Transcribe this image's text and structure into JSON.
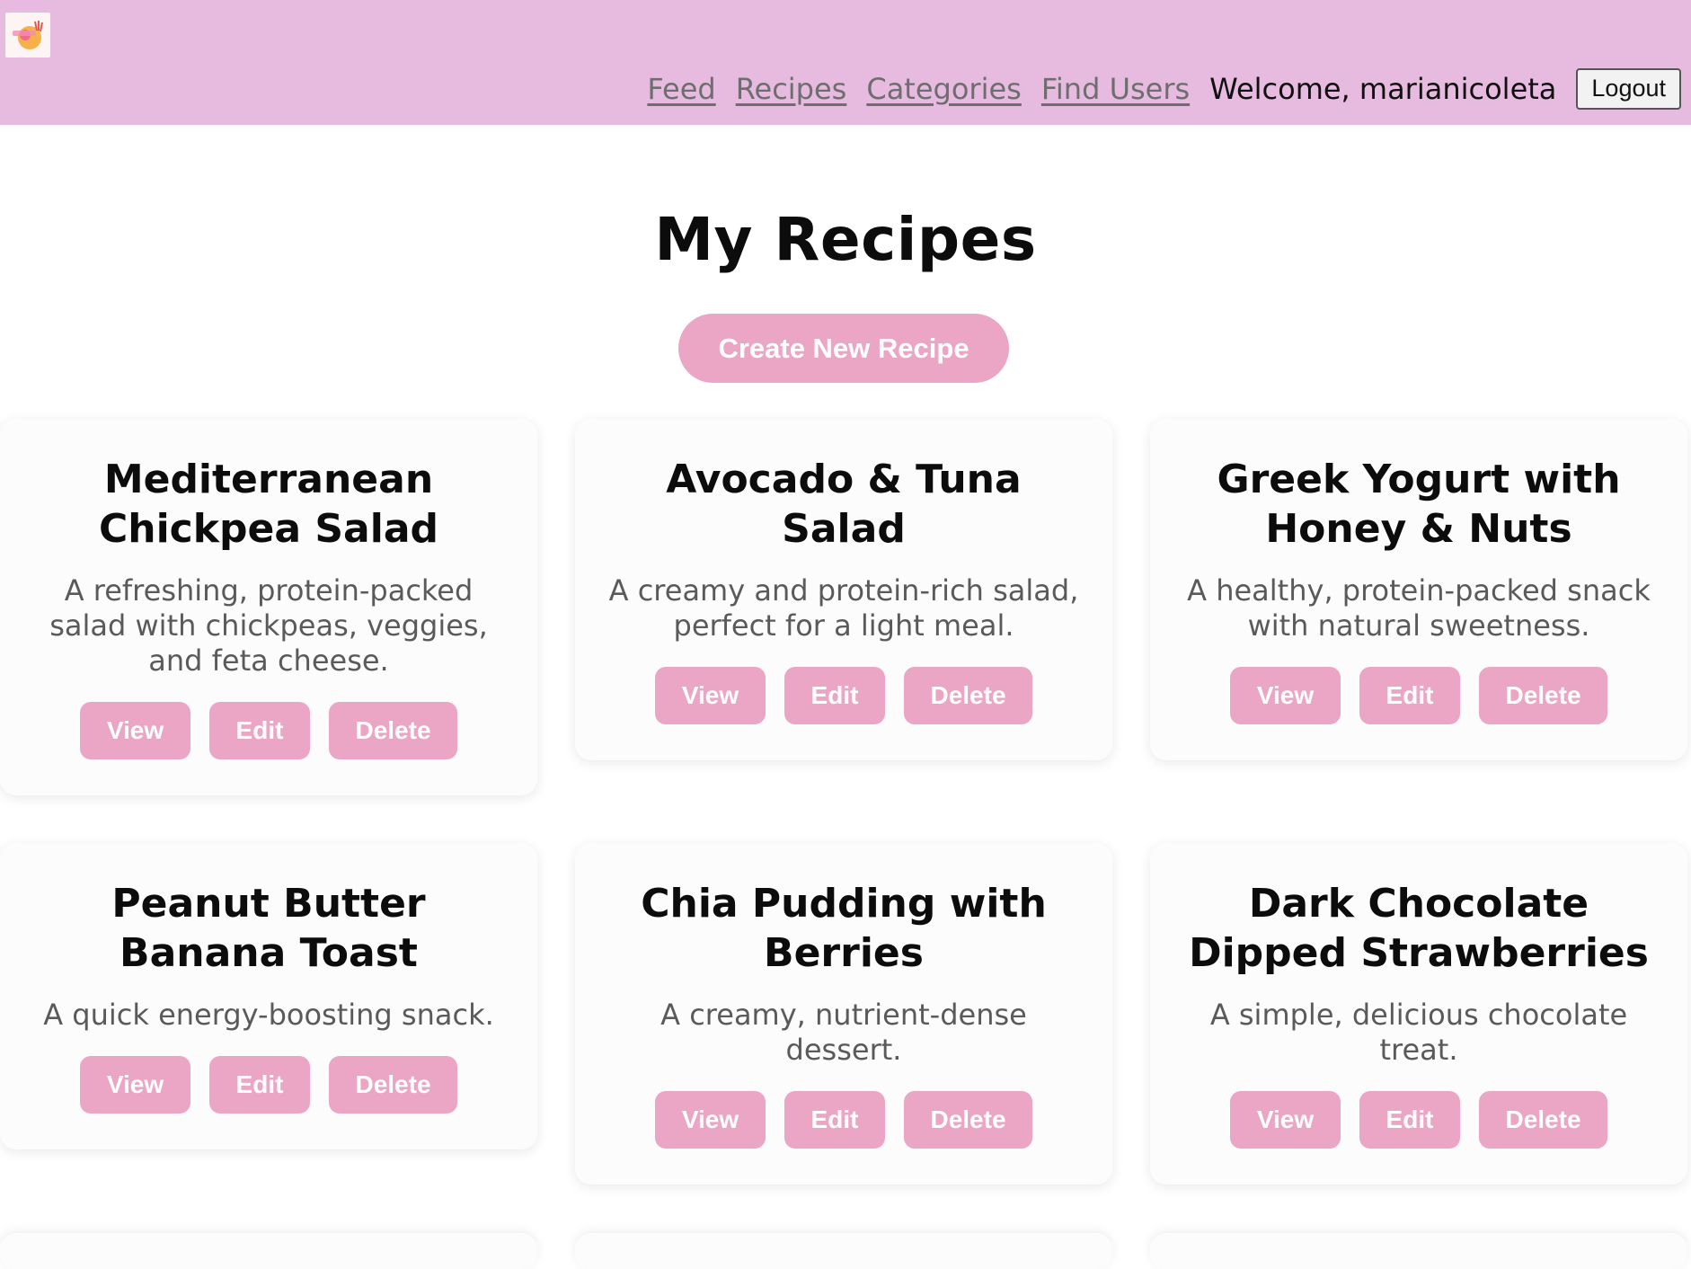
{
  "header": {
    "logo_alt": "logo",
    "nav": [
      {
        "label": "Feed"
      },
      {
        "label": "Recipes"
      },
      {
        "label": "Categories"
      },
      {
        "label": "Find Users"
      }
    ],
    "welcome": "Welcome, marianicoleta",
    "logout_label": "Logout"
  },
  "main": {
    "title": "My Recipes",
    "create_label": "Create New Recipe",
    "recipes": [
      {
        "title": "Mediterranean Chickpea Salad",
        "description": "A refreshing, protein-packed salad with chickpeas, veggies, and feta cheese.",
        "view": "View",
        "edit": "Edit",
        "delete": "Delete"
      },
      {
        "title": "Avocado & Tuna Salad",
        "description": "A creamy and protein-rich salad, perfect for a light meal.",
        "view": "View",
        "edit": "Edit",
        "delete": "Delete"
      },
      {
        "title": "Greek Yogurt with Honey & Nuts",
        "description": "A healthy, protein-packed snack with natural sweetness.",
        "view": "View",
        "edit": "Edit",
        "delete": "Delete"
      },
      {
        "title": "Peanut Butter Banana Toast",
        "description": "A quick energy-boosting snack.",
        "view": "View",
        "edit": "Edit",
        "delete": "Delete"
      },
      {
        "title": "Chia Pudding with Berries",
        "description": "A creamy, nutrient-dense dessert.",
        "view": "View",
        "edit": "Edit",
        "delete": "Delete"
      },
      {
        "title": "Dark Chocolate Dipped Strawberries",
        "description": "A simple, delicious chocolate treat.",
        "view": "View",
        "edit": "Edit",
        "delete": "Delete"
      }
    ]
  },
  "colors": {
    "header_bg": "#e6bbdf",
    "accent_pink": "#eba6c5",
    "link_gray": "#6e6e6e"
  }
}
